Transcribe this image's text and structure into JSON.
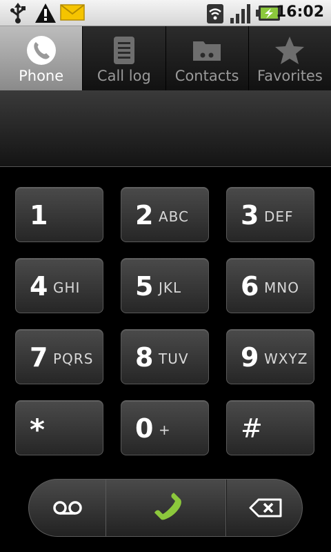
{
  "status_bar": {
    "time": "16:02",
    "left_icons": [
      "usb-icon",
      "warning-icon",
      "mail-icon"
    ],
    "right_icons": [
      "wifi-icon",
      "signal-icon",
      "battery-charging-icon"
    ]
  },
  "tabs": [
    {
      "label": "Phone",
      "icon": "phone-icon",
      "active": true
    },
    {
      "label": "Call log",
      "icon": "call-log-icon",
      "active": false
    },
    {
      "label": "Contacts",
      "icon": "contacts-icon",
      "active": false
    },
    {
      "label": "Favorites",
      "icon": "star-icon",
      "active": false
    }
  ],
  "display": {
    "number": ""
  },
  "keypad": [
    {
      "digit": "1",
      "letters": ""
    },
    {
      "digit": "2",
      "letters": "ABC"
    },
    {
      "digit": "3",
      "letters": "DEF"
    },
    {
      "digit": "4",
      "letters": "GHI"
    },
    {
      "digit": "5",
      "letters": "JKL"
    },
    {
      "digit": "6",
      "letters": "MNO"
    },
    {
      "digit": "7",
      "letters": "PQRS"
    },
    {
      "digit": "8",
      "letters": "TUV"
    },
    {
      "digit": "9",
      "letters": "WXYZ"
    },
    {
      "digit": "*",
      "letters": ""
    },
    {
      "digit": "0",
      "letters": "+"
    },
    {
      "digit": "#",
      "letters": ""
    }
  ],
  "bottom_bar": {
    "voicemail_icon": "voicemail-icon",
    "call_icon": "call-icon",
    "delete_icon": "backspace-icon",
    "call_color": "#8cc83c"
  }
}
